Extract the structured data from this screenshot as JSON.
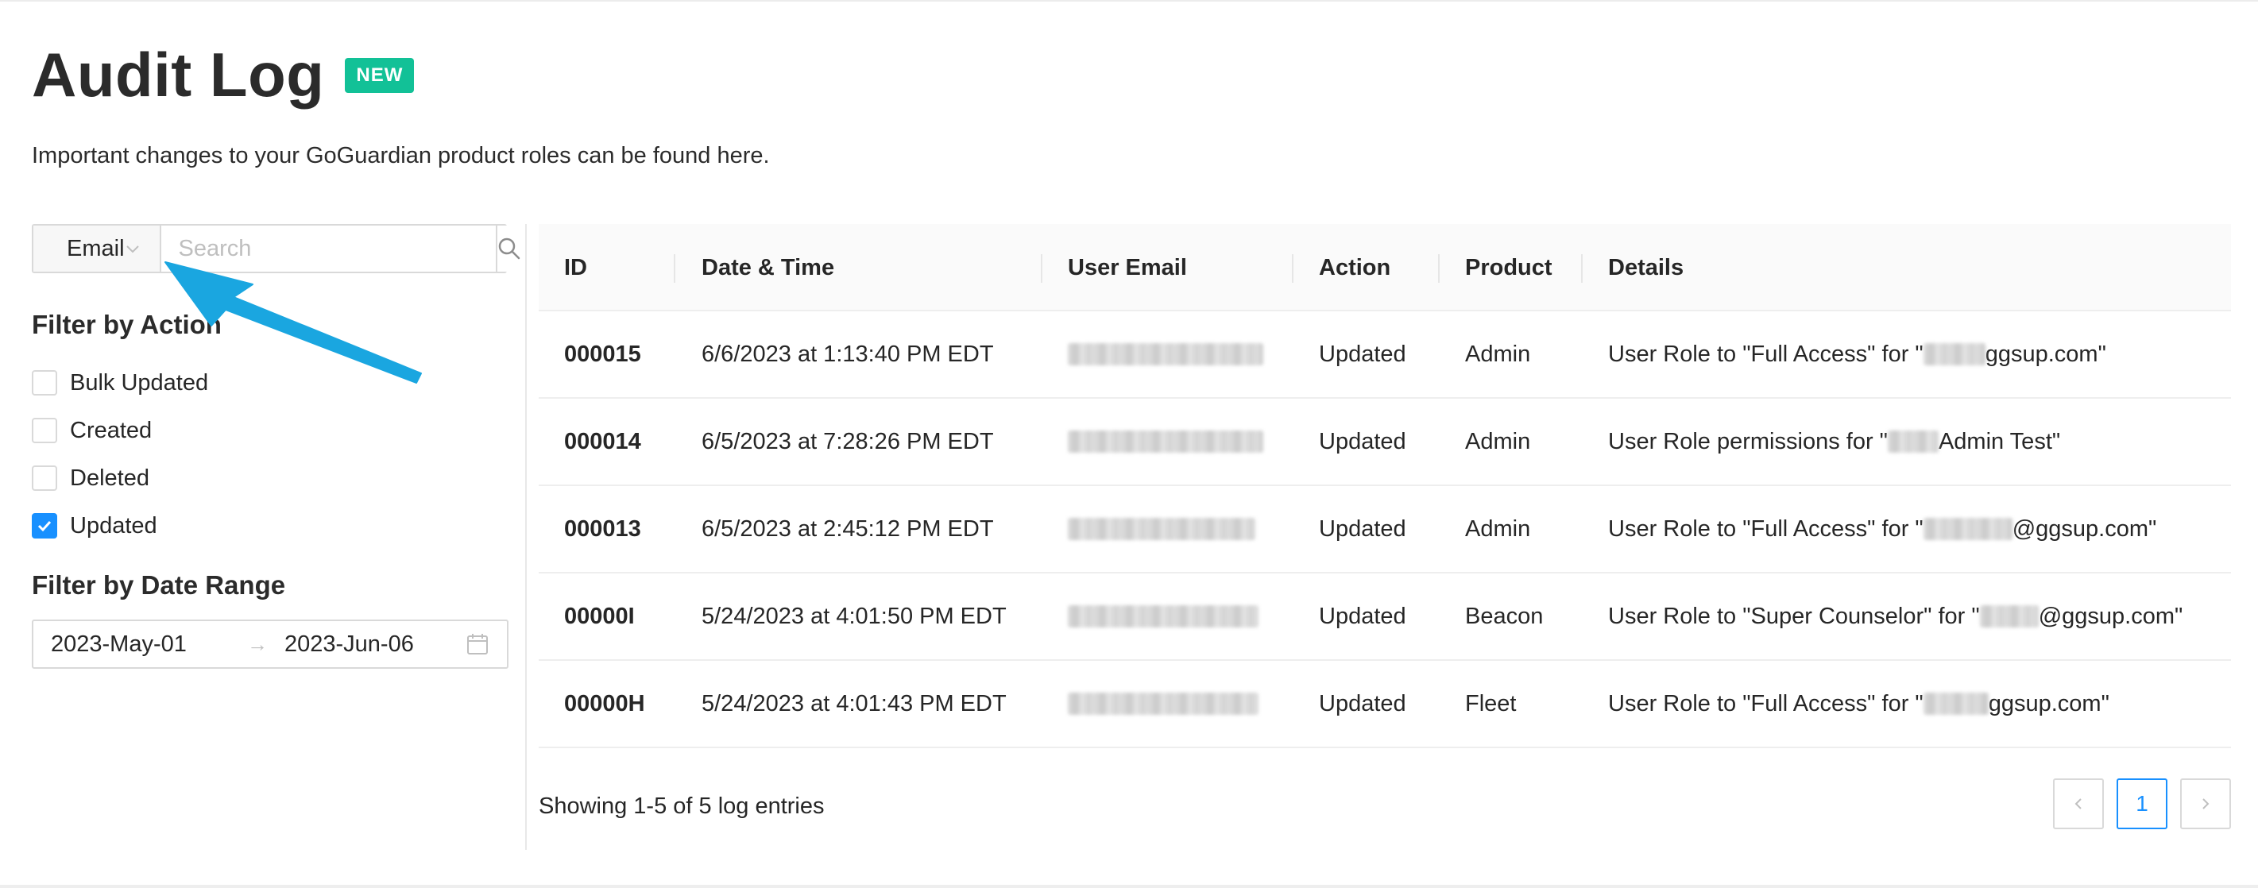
{
  "page": {
    "title": "Audit Log",
    "badge": "NEW",
    "subtitle": "Important changes to your GoGuardian product roles can be found here."
  },
  "search": {
    "field_select": "Email",
    "placeholder": "Search"
  },
  "filters": {
    "action_title": "Filter by Action",
    "actions": [
      {
        "label": "Bulk Updated",
        "checked": false
      },
      {
        "label": "Created",
        "checked": false
      },
      {
        "label": "Deleted",
        "checked": false
      },
      {
        "label": "Updated",
        "checked": true
      }
    ],
    "date_title": "Filter by Date Range",
    "date_start": "2023-May-01",
    "date_end": "2023-Jun-06"
  },
  "table": {
    "headers": [
      "ID",
      "Date & Time",
      "User Email",
      "Action",
      "Product",
      "Details"
    ],
    "rows": [
      {
        "id": "000015",
        "datetime": "6/6/2023 at 1:13:40 PM EDT",
        "action": "Updated",
        "product": "Admin",
        "details_pre": "User Role to \"Full Access\" for \"",
        "details_post": "ggsup.com\""
      },
      {
        "id": "000014",
        "datetime": "6/5/2023 at 7:28:26 PM EDT",
        "action": "Updated",
        "product": "Admin",
        "details_pre": "User Role permissions for \"",
        "details_post": " Admin Test\""
      },
      {
        "id": "000013",
        "datetime": "6/5/2023 at 2:45:12 PM EDT",
        "action": "Updated",
        "product": "Admin",
        "details_pre": "User Role to \"Full Access\" for \"",
        "details_post": "@ggsup.com\""
      },
      {
        "id": "00000I",
        "datetime": "5/24/2023 at 4:01:50 PM EDT",
        "action": "Updated",
        "product": "Beacon",
        "details_pre": "User Role to \"Super Counselor\" for \"",
        "details_post": "@ggsup.com\""
      },
      {
        "id": "00000H",
        "datetime": "5/24/2023 at 4:01:43 PM EDT",
        "action": "Updated",
        "product": "Fleet",
        "details_pre": "User Role to \"Full Access\" for \"",
        "details_post": "ggsup.com\""
      }
    ]
  },
  "footer": {
    "showing": "Showing 1-5 of 5 log entries",
    "current_page": "1"
  },
  "icons": {
    "search": "search-icon",
    "chevron": "chevron-down-icon",
    "calendar": "calendar-icon",
    "check": "check-icon",
    "prev": "chevron-left-icon",
    "next": "chevron-right-icon",
    "annotation_arrow": "arrow-annotation"
  },
  "colors": {
    "badge": "#12c197",
    "accent": "#1890ff",
    "annotation_arrow": "#1aa6e0"
  }
}
